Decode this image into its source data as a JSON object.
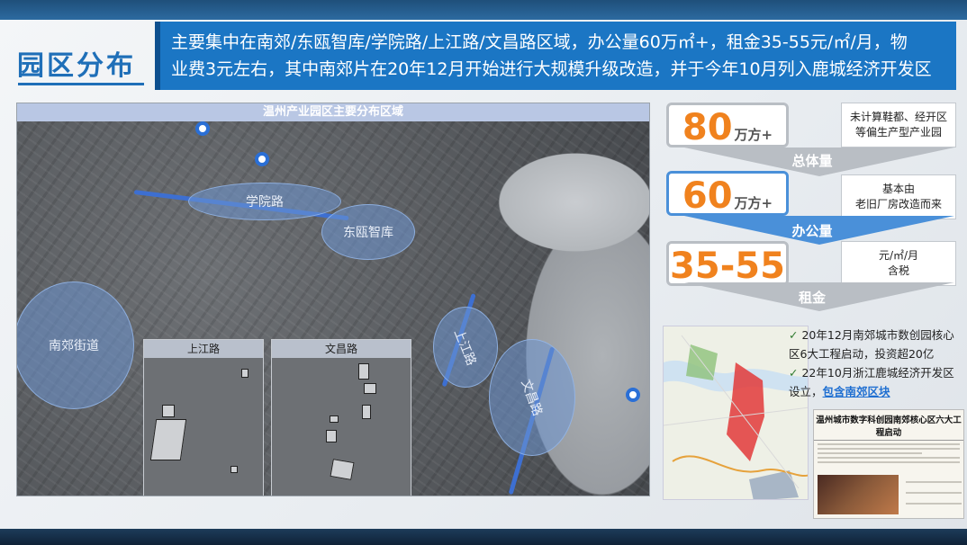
{
  "page": {
    "title": "园区分布",
    "summary_line1": "主要集中在南郊/东瓯智库/学院路/上江路/文昌路区域，办公量60万㎡+，租金35-55元/㎡/月，物",
    "summary_line2": "业费3元左右，其中南郊片在20年12月开始进行大规模升级改造，并于今年10月列入鹿城经济开发区"
  },
  "map": {
    "header": "温州产业园区主要分布区域",
    "zones": [
      "学院路",
      "东瓯智库",
      "南郊街道",
      "上江路",
      "文昌路"
    ],
    "insets": [
      "上江路",
      "文昌路"
    ],
    "accent_color": "#3d6fd1"
  },
  "stats": [
    {
      "value": "80",
      "unit": "万方+",
      "note_line1": "未计算鞋都、经开区",
      "note_line2": "等偏生产型产业园",
      "label": "总体量"
    },
    {
      "value": "60",
      "unit": "万方+",
      "note_line1": "基本由",
      "note_line2": "老旧厂房改造而来",
      "label": "办公量"
    },
    {
      "value": "35-55",
      "unit": "",
      "note_line1": "元/㎡/月",
      "note_line2": "含税",
      "label": "租金"
    }
  ],
  "bullets": {
    "item1": "20年12月南郊城市数创园核心区6大工程启动，投资超20亿",
    "item2_prefix": "22年10月浙江鹿城经济开发区设立，",
    "item2_highlight": "包含南郊区块"
  },
  "newspaper": {
    "headline": "温州城市数字科创园南郊核心区六大工程启动"
  },
  "colors": {
    "brand_blue": "#1b76c4",
    "number_orange": "#f0821e"
  }
}
